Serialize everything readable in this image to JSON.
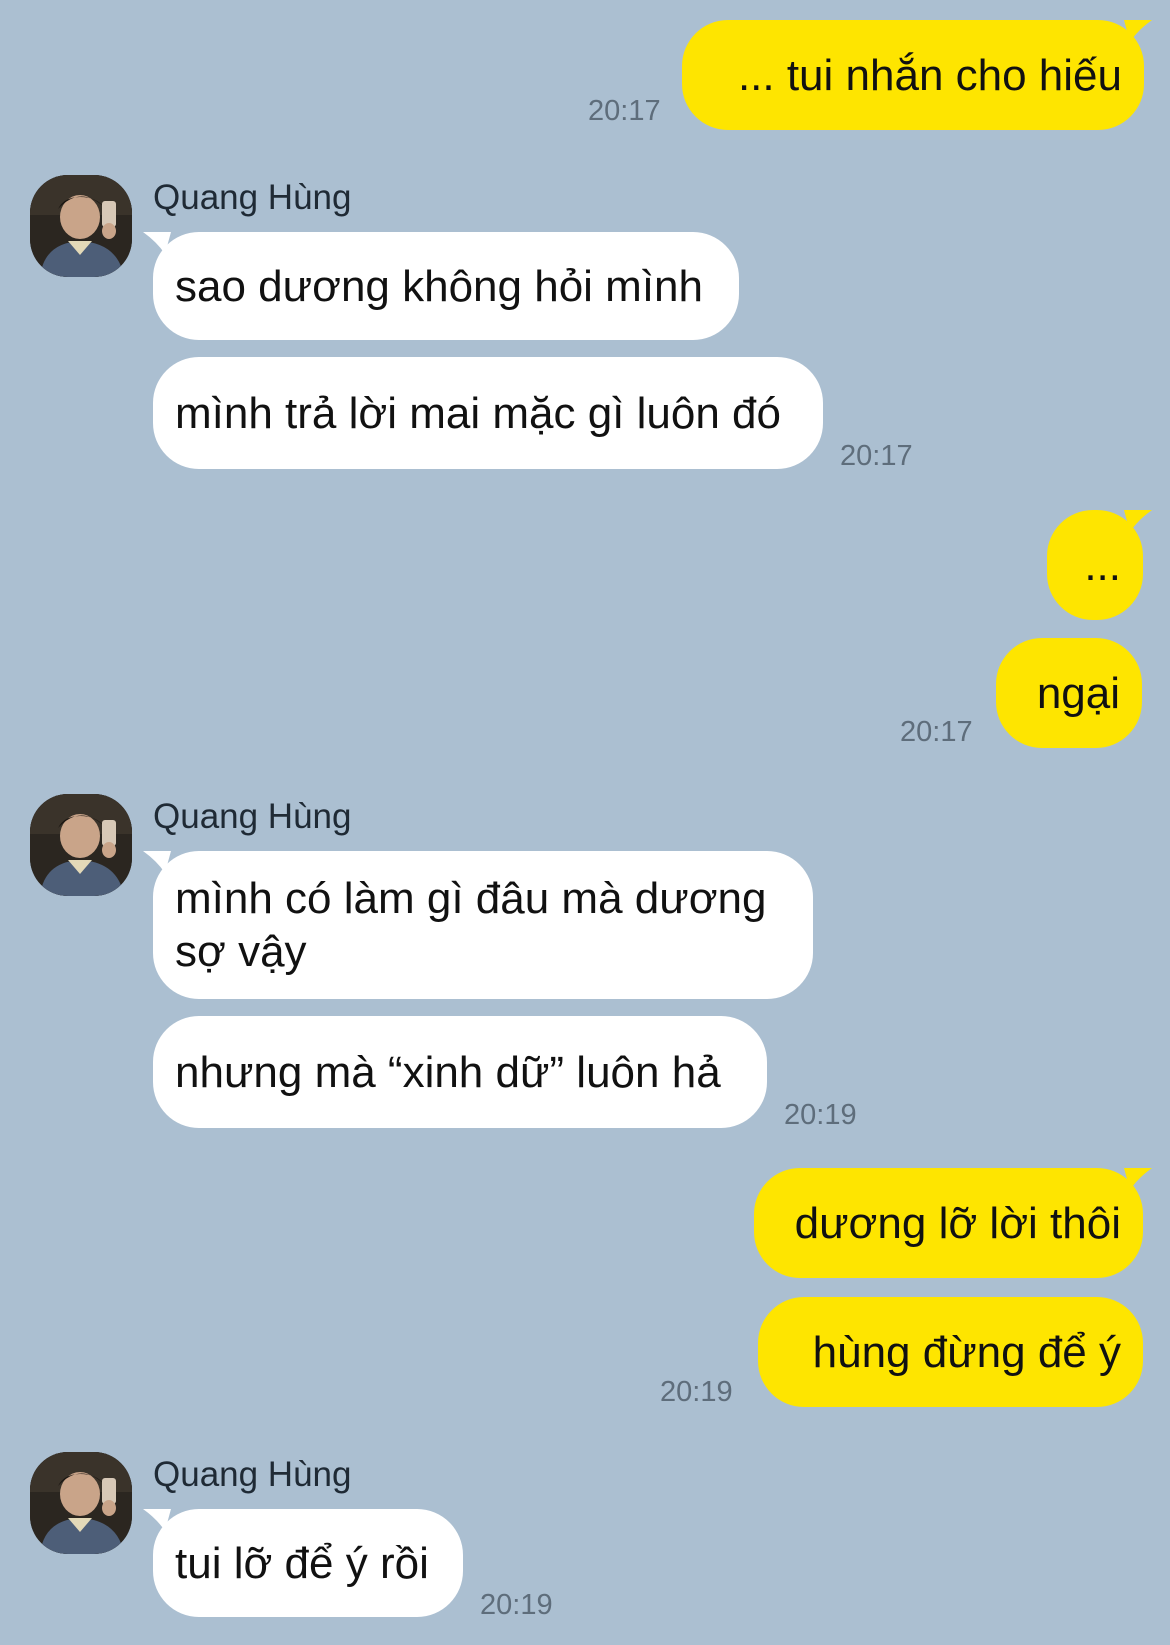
{
  "contact": {
    "name": "Quang Hùng"
  },
  "messages": {
    "m1": {
      "text": "... tui nhắn cho hiếu",
      "time": "20:17"
    },
    "g1": {
      "name": "Quang Hùng",
      "b1": "sao dương không hỏi mình",
      "b2": "mình trả lời mai mặc gì luôn đó",
      "time": "20:17"
    },
    "m2": {
      "b1": "...",
      "b2": "ngại",
      "time": "20:17"
    },
    "g2": {
      "name": "Quang Hùng",
      "b1": "mình có làm gì đâu mà dương sợ vậy",
      "b2": "nhưng mà “xinh dữ” luôn hả",
      "time": "20:19"
    },
    "m3": {
      "b1": "dương lỡ lời thôi",
      "b2": "hùng đừng để ý",
      "time": "20:19"
    },
    "g3": {
      "name": "Quang Hùng",
      "b1": "tui lỡ để ý rồi",
      "time": "20:19"
    }
  },
  "colors": {
    "background": "#abbfd1",
    "outgoing": "#fee500",
    "incoming": "#ffffff",
    "time": "#5e6d7b"
  },
  "icons": {
    "avatar": "avatar-photo"
  }
}
